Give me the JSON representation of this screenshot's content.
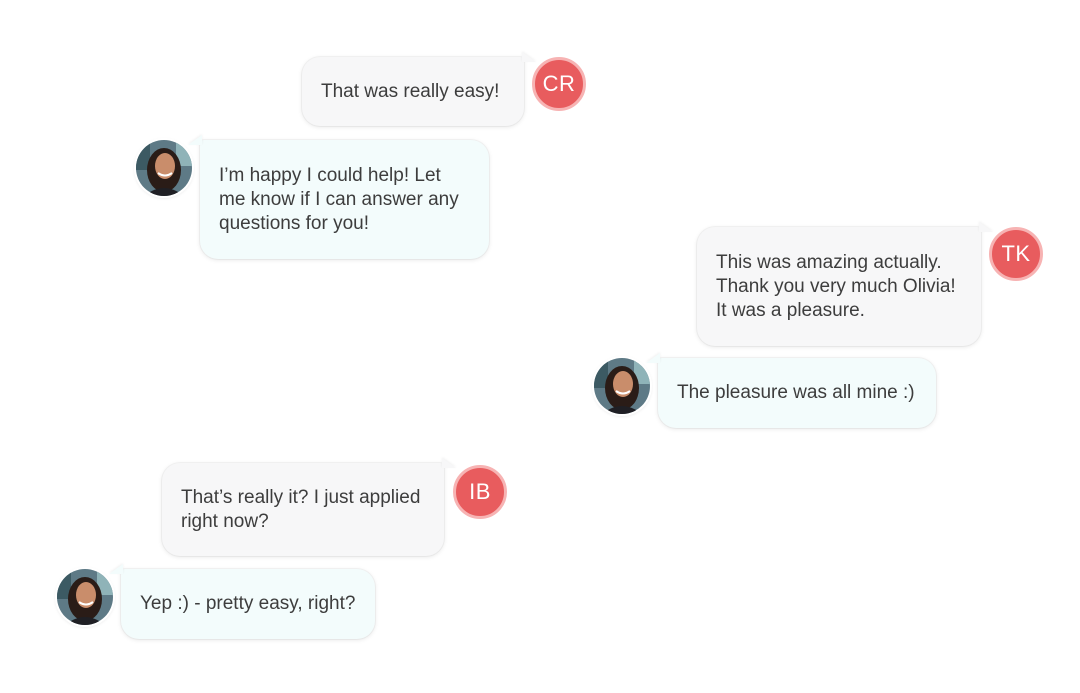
{
  "colors": {
    "initials_avatar": "#e85c5e",
    "customer_bubble": "#f7f7f8",
    "agent_bubble": "#f3fcfc",
    "text": "#3d3d3d"
  },
  "messages": [
    {
      "sender": "customer",
      "initials": "CR",
      "text": "That was really easy!"
    },
    {
      "sender": "agent",
      "avatar": "agent-avatar-photo",
      "text": "I’m happy I could help! Let\nme know if I can answer any\nquestions for you!"
    },
    {
      "sender": "customer",
      "initials": "TK",
      "text": "This was amazing actually.\nThank you very much Olivia!\nIt was a pleasure."
    },
    {
      "sender": "agent",
      "avatar": "agent-avatar-photo",
      "text": "The pleasure was all mine :)"
    },
    {
      "sender": "customer",
      "initials": "IB",
      "text": "That’s really it? I just applied\nright now?"
    },
    {
      "sender": "agent",
      "avatar": "agent-avatar-photo",
      "text": "Yep :) - pretty easy, right?"
    }
  ]
}
